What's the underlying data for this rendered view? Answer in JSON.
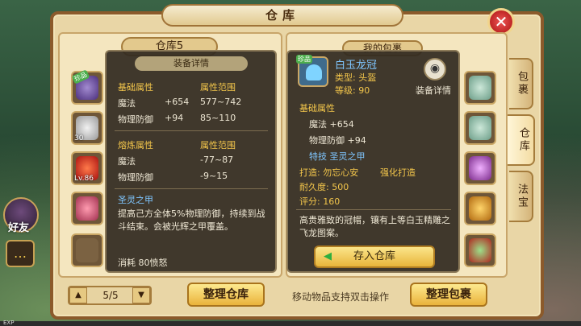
{
  "window": {
    "title": "仓库",
    "close_icon": "close-x-icon"
  },
  "left_chars": {
    "friend_label": "好友"
  },
  "warehouse": {
    "selector": "仓库5",
    "pager": "5/5",
    "sort_button": "整理仓库",
    "slots": [
      {
        "lv": "",
        "tag": "珍品"
      },
      {
        "lv": "30",
        "tag": ""
      },
      {
        "lv": "Lv.86",
        "tag": ""
      },
      {
        "lv": "",
        "tag": ""
      },
      {
        "lv": "",
        "tag": ""
      }
    ]
  },
  "bag": {
    "title": "我的包裹",
    "sort_button": "整理包裹",
    "hint": "移动物品支持双击操作"
  },
  "side_tabs": [
    "包裹",
    "仓库",
    "法宝"
  ],
  "tip_left": {
    "title": "装备详情",
    "h1": "基础属性",
    "h2": "属性范围",
    "r1": [
      "魔法",
      "+654",
      "577~742"
    ],
    "r2": [
      "物理防御",
      "+94",
      "85~110"
    ],
    "h3": "熔炼属性",
    "h4": "属性范围",
    "r3": [
      "魔法",
      "-77~87"
    ],
    "r4": [
      "物理防御",
      "-9~15"
    ],
    "skill": "圣灵之甲",
    "desc": "提高己方全体5%物理防御，持续到战斗结束。会被光辉之甲覆盖。",
    "cost": "消耗 80愤怒"
  },
  "tip_right": {
    "tag": "珍品",
    "name": "白玉龙冠",
    "type": "类型: 头盔",
    "level": "等级: 90",
    "detail_label": "装备详情",
    "h1": "基础属性",
    "r1": "魔法 +654",
    "r2": "物理防御 +94",
    "skill": "特技 圣灵之甲",
    "forge": "打造: 勿忘心安",
    "enhance": "强化打造",
    "durability": "耐久度: 500",
    "score": "评分: 160",
    "desc": "高贵雅致的冠帽，镶有上等白玉精雕之飞龙图案。",
    "store_button": "存入仓库"
  },
  "exp_label": "EXP"
}
